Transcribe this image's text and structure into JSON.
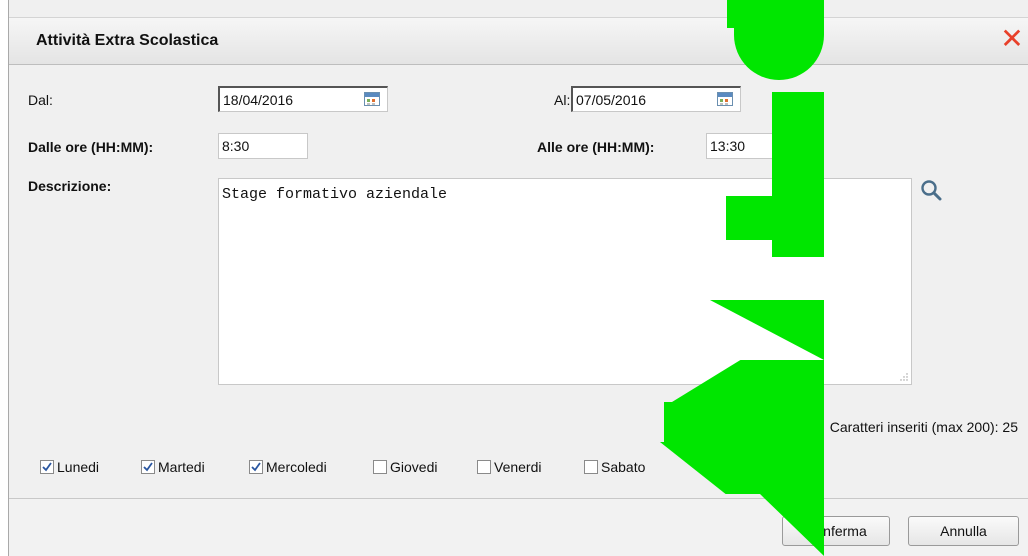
{
  "dialog": {
    "title": "Attività Extra Scolastica"
  },
  "form": {
    "dal_label": "Dal:",
    "dal_value": "18/04/2016",
    "al_label": "Al:",
    "al_value": "07/05/2016",
    "dalle_ore_label": "Dalle ore (HH:MM):",
    "dalle_ore_value": "8:30",
    "alle_ore_label": "Alle ore (HH:MM):",
    "alle_ore_value": "13:30",
    "descrizione_label": "Descrizione:",
    "descrizione_value": "Stage formativo aziendale",
    "count_text": "Caratteri inseriti (max 200): 25"
  },
  "days": [
    {
      "label": "Lunedi",
      "checked": true
    },
    {
      "label": "Martedi",
      "checked": true
    },
    {
      "label": "Mercoledi",
      "checked": true
    },
    {
      "label": "Giovedi",
      "checked": false
    },
    {
      "label": "Venerdi",
      "checked": false
    },
    {
      "label": "Sabato",
      "checked": false
    }
  ],
  "buttons": {
    "confirm": "Conferma",
    "cancel": "Annulla"
  },
  "colors": {
    "close": "#e8402a",
    "overlay": "#00e600",
    "search_icon": "#4a6e8a"
  }
}
